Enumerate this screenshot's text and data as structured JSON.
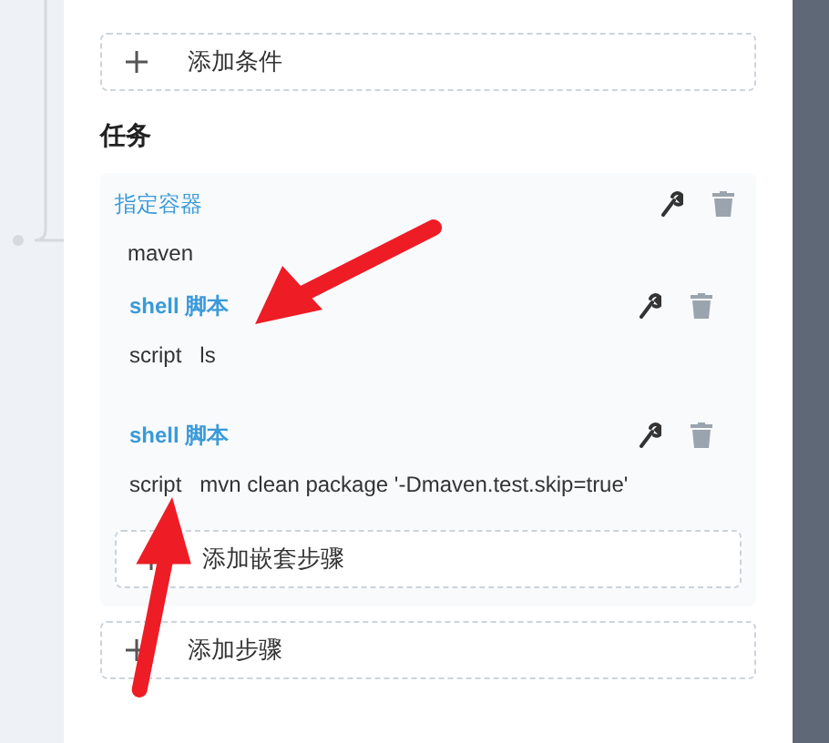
{
  "add_condition": {
    "label": "添加条件"
  },
  "tasks": {
    "heading": "任务",
    "container": {
      "title": "指定容器",
      "value": "maven",
      "steps": [
        {
          "title": "shell 脚本",
          "label": "script",
          "value": "ls"
        },
        {
          "title": "shell 脚本",
          "label": "script",
          "value": "mvn clean package '-Dmaven.test.skip=true'"
        }
      ],
      "add_nested": {
        "label": "添加嵌套步骤"
      }
    },
    "add_step": {
      "label": "添加步骤"
    }
  }
}
